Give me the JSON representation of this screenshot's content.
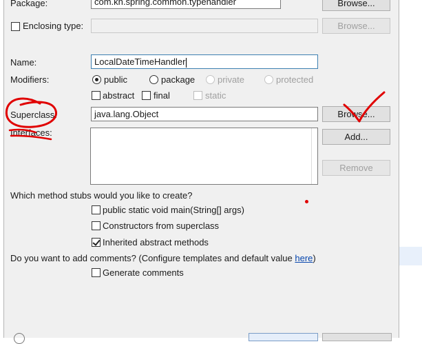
{
  "package": {
    "label": "Package:",
    "value": "com.kh.spring.common.typehandler",
    "browse_label": "Browse..."
  },
  "enclosing": {
    "label": "Enclosing type:",
    "value": "",
    "browse_label": "Browse..."
  },
  "name": {
    "label": "Name:",
    "value": "LocalDateTimeHandler"
  },
  "modifiers": {
    "label": "Modifiers:",
    "options": [
      "public",
      "package",
      "private",
      "protected"
    ],
    "selected": "public",
    "flags": [
      "abstract",
      "final",
      "static"
    ]
  },
  "superclass": {
    "label": "Superclass:",
    "value": "java.lang.Object",
    "browse_label": "Browse..."
  },
  "interfaces": {
    "label": "Interfaces:",
    "add_label": "Add...",
    "remove_label": "Remove"
  },
  "stubs": {
    "question": "Which method stubs would you like to create?",
    "options": [
      {
        "label": "public static void main(String[] args)",
        "checked": false
      },
      {
        "label": "Constructors from superclass",
        "checked": false
      },
      {
        "label": "Inherited abstract methods",
        "checked": true
      }
    ]
  },
  "comments": {
    "question": "Do you want to add comments? (Configure templates and default value",
    "link": "here",
    "suffix": ")",
    "generate_label": "Generate comments",
    "checked": false
  },
  "colors": {
    "dialog_bg": "#f0f0f0",
    "annotation_red": "#e00000",
    "link": "#0645ad"
  }
}
